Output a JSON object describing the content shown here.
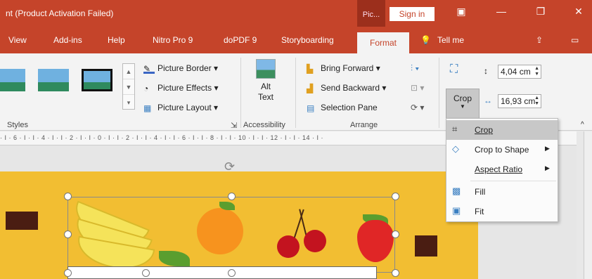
{
  "title": "nt (Product Activation Failed)",
  "context_tab": "Pic...",
  "signin": "Sign in",
  "tabs": [
    {
      "label": "View"
    },
    {
      "label": "Add-ins"
    },
    {
      "label": "Help"
    },
    {
      "label": "Nitro Pro 9"
    },
    {
      "label": "doPDF 9"
    },
    {
      "label": "Storyboarding"
    },
    {
      "label": "Format"
    },
    {
      "label": "Tell me"
    }
  ],
  "ribbon": {
    "picture_border": "Picture Border",
    "picture_effects": "Picture Effects",
    "picture_layout": "Picture Layout",
    "styles_label": "Styles",
    "alt_text_line1": "Alt",
    "alt_text_line2": "Text",
    "accessibility_label": "Accessibility",
    "bring_forward": "Bring Forward",
    "send_backward": "Send Backward",
    "selection_pane": "Selection Pane",
    "arrange_label": "Arrange",
    "crop_label": "Crop",
    "height_value": "4,04 cm",
    "width_value": "16,93 cm"
  },
  "ruler_text": "· I · 6 · I · I · 4 · I · I · 2 · I · I · 0 · I · I · 2 · I · I · 4 · I · I · 6 · I · I · 8 · I · I · 10 · I · I · 12 · I · I · 14 · I ·",
  "crop_menu": {
    "crop": "Crop",
    "crop_to_shape": "Crop to Shape",
    "aspect_ratio": "Aspect Ratio",
    "fill": "Fill",
    "fit": "Fit"
  },
  "colors": {
    "accent": "#c5442a",
    "slide_bg": "#f2be32"
  }
}
